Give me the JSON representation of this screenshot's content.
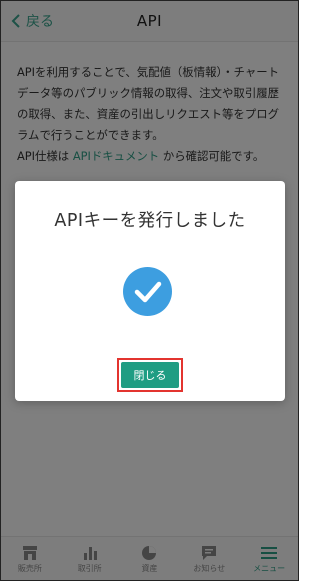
{
  "header": {
    "back_label": "戻る",
    "title": "API"
  },
  "content": {
    "description": "APIを利用することで、気配値（板情報）・チャートデータ等のパブリック情報の取得、注文や取引履歴の取得、また、資産の引出しリクエスト等をプログラムで行うことができます。",
    "spec_prefix": "API仕様は",
    "spec_link": "APIドキュメント",
    "spec_suffix": "から確認可能です。"
  },
  "modal": {
    "title": "APIキーを発行しました",
    "close_label": "閉じる"
  },
  "tabs": [
    {
      "label": "販売所",
      "icon": "store-icon"
    },
    {
      "label": "取引所",
      "icon": "bar-chart-icon"
    },
    {
      "label": "資産",
      "icon": "pie-chart-icon"
    },
    {
      "label": "お知らせ",
      "icon": "message-icon"
    },
    {
      "label": "メニュー",
      "icon": "menu-icon",
      "active": true
    }
  ],
  "colors": {
    "accent": "#2f9e86",
    "check": "#3d9ee0",
    "highlight": "#e3342f"
  }
}
